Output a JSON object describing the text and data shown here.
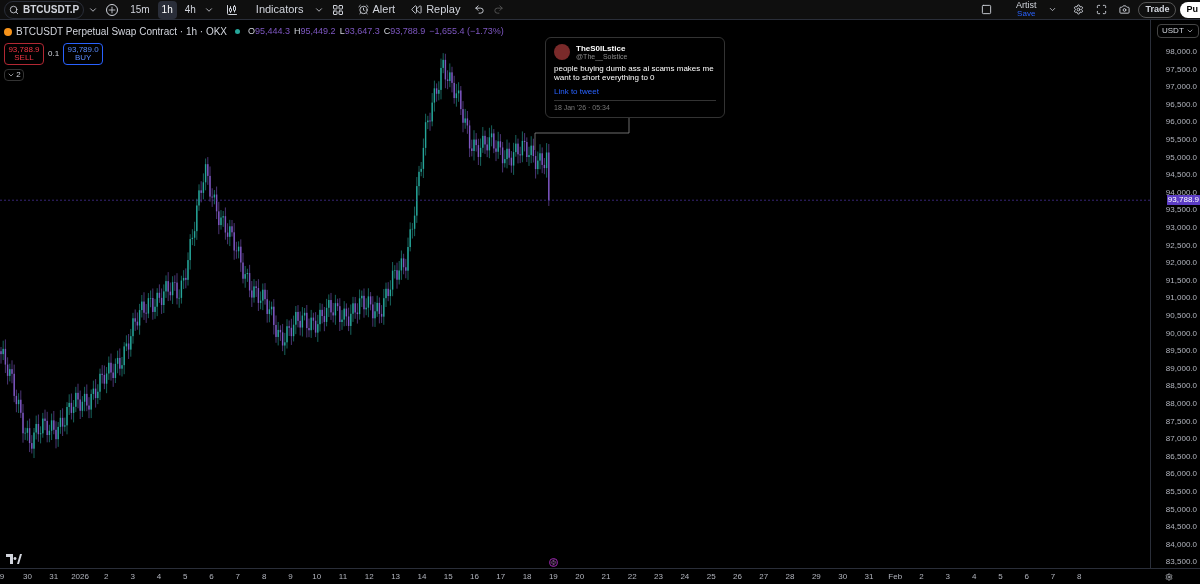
{
  "toolbar": {
    "symbol": "BTCUSDT.P",
    "intervals": [
      {
        "label": "15m",
        "selected": false
      },
      {
        "label": "1h",
        "selected": true
      },
      {
        "label": "4h",
        "selected": false
      }
    ],
    "indicators": "Indicators",
    "alert": "Alert",
    "replay": "Replay",
    "layout_name": "Artist",
    "save": "Save",
    "trade": "Trade",
    "publish": "Pu"
  },
  "legend": {
    "title": "BTCUSDT Perpetual Swap Contract · 1h · OKX",
    "ohlc": [
      {
        "letter": "O",
        "value": "95,444.3"
      },
      {
        "letter": "H",
        "value": "95,449.2"
      },
      {
        "letter": "L",
        "value": "93,647.3"
      },
      {
        "letter": "C",
        "value": "93,788.9"
      }
    ],
    "change": "−1,655.4 (−1.73%)",
    "sell_price": "93,788.9",
    "sell": "SELL",
    "quantity": "0.1",
    "buy_price": "93,789.0",
    "buy": "BUY",
    "collapsed_count": "2"
  },
  "tweet": {
    "name": "TheS0lLstice",
    "handle": "@The__Solstice",
    "text": "people buying dumb ass ai scams makes me want to short everything to 0",
    "link": "Link to tweet",
    "date": "18 Jan '26 · 05:34"
  },
  "price_axis": {
    "currency": "USDT",
    "current": "93,788.9",
    "ticks": [
      "98,000.0",
      "97,500.0",
      "97,000.0",
      "96,500.0",
      "96,000.0",
      "95,500.0",
      "95,000.0",
      "94,500.0",
      "94,000.0",
      "93,500.0",
      "93,000.0",
      "92,500.0",
      "92,000.0",
      "91,500.0",
      "91,000.0",
      "90,500.0",
      "90,000.0",
      "89,500.0",
      "89,000.0",
      "88,500.0",
      "88,000.0",
      "87,500.0",
      "87,000.0",
      "86,500.0",
      "86,000.0",
      "85,500.0",
      "85,000.0",
      "84,500.0",
      "84,000.0",
      "83,500.0"
    ]
  },
  "time_axis": [
    "9",
    "30",
    "31",
    "2026",
    "2",
    "3",
    "4",
    "5",
    "6",
    "7",
    "8",
    "9",
    "10",
    "11",
    "12",
    "13",
    "14",
    "15",
    "16",
    "17",
    "18",
    "19",
    "20",
    "21",
    "22",
    "23",
    "24",
    "25",
    "26",
    "27",
    "28",
    "29",
    "30",
    "31",
    "Feb",
    "2",
    "3",
    "4",
    "5",
    "6",
    "7",
    "8"
  ]
}
